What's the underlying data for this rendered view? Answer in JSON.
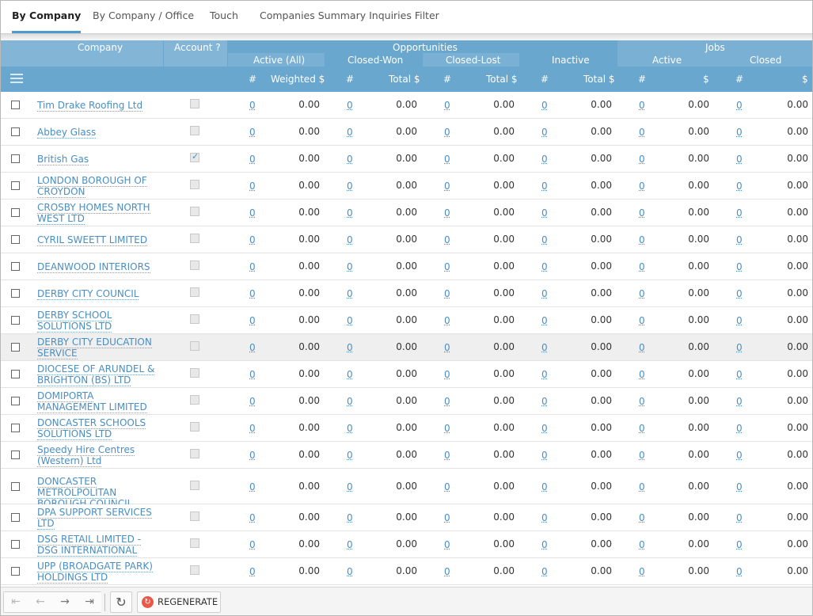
{
  "tabs": [
    {
      "label": "By Company",
      "active": true
    },
    {
      "label": "By Company / Office",
      "active": false
    },
    {
      "label": "Touch",
      "active": false
    },
    {
      "label": "Companies Summary Inquiries Filter",
      "active": false
    }
  ],
  "header": {
    "company": "Company",
    "account": "Account ?",
    "opportunities": "Opportunities",
    "jobs": "Jobs",
    "groups": [
      "Active (All)",
      "Closed-Won",
      "Closed-Lost",
      "Inactive",
      "Active",
      "Closed"
    ],
    "sub": [
      "#",
      "Weighted $",
      "#",
      "Total $",
      "#",
      "Total $",
      "#",
      "Total $",
      "#",
      "$",
      "#",
      "$"
    ]
  },
  "rows": [
    {
      "company": "Tim Drake Roofing Ltd",
      "account": false,
      "counts": [
        "0",
        "0",
        "0",
        "0",
        "0",
        "0"
      ],
      "amounts": [
        "0.00",
        "0.00",
        "0.00",
        "0.00",
        "0.00",
        "0.00"
      ]
    },
    {
      "company": "Abbey Glass",
      "account": false,
      "counts": [
        "0",
        "0",
        "0",
        "0",
        "0",
        "0"
      ],
      "amounts": [
        "0.00",
        "0.00",
        "0.00",
        "0.00",
        "0.00",
        "0.00"
      ]
    },
    {
      "company": "British Gas",
      "account": true,
      "counts": [
        "0",
        "0",
        "0",
        "0",
        "0",
        "0"
      ],
      "amounts": [
        "0.00",
        "0.00",
        "0.00",
        "0.00",
        "0.00",
        "0.00"
      ]
    },
    {
      "company": "LONDON BOROUGH OF CROYDON",
      "account": false,
      "counts": [
        "0",
        "0",
        "0",
        "0",
        "0",
        "0"
      ],
      "amounts": [
        "0.00",
        "0.00",
        "0.00",
        "0.00",
        "0.00",
        "0.00"
      ]
    },
    {
      "company": "CROSBY HOMES NORTH WEST LTD",
      "account": false,
      "counts": [
        "0",
        "0",
        "0",
        "0",
        "0",
        "0"
      ],
      "amounts": [
        "0.00",
        "0.00",
        "0.00",
        "0.00",
        "0.00",
        "0.00"
      ]
    },
    {
      "company": "CYRIL SWEETT LIMITED",
      "account": false,
      "counts": [
        "0",
        "0",
        "0",
        "0",
        "0",
        "0"
      ],
      "amounts": [
        "0.00",
        "0.00",
        "0.00",
        "0.00",
        "0.00",
        "0.00"
      ]
    },
    {
      "company": "DEANWOOD INTERIORS",
      "account": false,
      "counts": [
        "0",
        "0",
        "0",
        "0",
        "0",
        "0"
      ],
      "amounts": [
        "0.00",
        "0.00",
        "0.00",
        "0.00",
        "0.00",
        "0.00"
      ]
    },
    {
      "company": "DERBY CITY COUNCIL",
      "account": false,
      "counts": [
        "0",
        "0",
        "0",
        "0",
        "0",
        "0"
      ],
      "amounts": [
        "0.00",
        "0.00",
        "0.00",
        "0.00",
        "0.00",
        "0.00"
      ]
    },
    {
      "company": "DERBY SCHOOL SOLUTIONS LTD",
      "account": false,
      "counts": [
        "0",
        "0",
        "0",
        "0",
        "0",
        "0"
      ],
      "amounts": [
        "0.00",
        "0.00",
        "0.00",
        "0.00",
        "0.00",
        "0.00"
      ]
    },
    {
      "company": "DERBY CITY EDUCATION SERVICE",
      "account": false,
      "highlight": true,
      "counts": [
        "0",
        "0",
        "0",
        "0",
        "0",
        "0"
      ],
      "amounts": [
        "0.00",
        "0.00",
        "0.00",
        "0.00",
        "0.00",
        "0.00"
      ]
    },
    {
      "company": "DIOCESE OF ARUNDEL & BRIGHTON (BS) LTD",
      "account": false,
      "counts": [
        "0",
        "0",
        "0",
        "0",
        "0",
        "0"
      ],
      "amounts": [
        "0.00",
        "0.00",
        "0.00",
        "0.00",
        "0.00",
        "0.00"
      ]
    },
    {
      "company": "DOMIPORTA MANAGEMENT LIMITED",
      "account": false,
      "counts": [
        "0",
        "0",
        "0",
        "0",
        "0",
        "0"
      ],
      "amounts": [
        "0.00",
        "0.00",
        "0.00",
        "0.00",
        "0.00",
        "0.00"
      ]
    },
    {
      "company": "DONCASTER SCHOOLS SOLUTIONS LTD",
      "account": false,
      "counts": [
        "0",
        "0",
        "0",
        "0",
        "0",
        "0"
      ],
      "amounts": [
        "0.00",
        "0.00",
        "0.00",
        "0.00",
        "0.00",
        "0.00"
      ]
    },
    {
      "company": "Speedy Hire Centres (Western) Ltd",
      "account": false,
      "counts": [
        "0",
        "0",
        "0",
        "0",
        "0",
        "0"
      ],
      "amounts": [
        "0.00",
        "0.00",
        "0.00",
        "0.00",
        "0.00",
        "0.00"
      ]
    },
    {
      "company": "DONCASTER METROLPOLITAN BOROUGH COUNCIL",
      "account": false,
      "counts": [
        "0",
        "0",
        "0",
        "0",
        "0",
        "0"
      ],
      "amounts": [
        "0.00",
        "0.00",
        "0.00",
        "0.00",
        "0.00",
        "0.00"
      ]
    },
    {
      "company": "DPA SUPPORT SERVICES LTD",
      "account": false,
      "counts": [
        "0",
        "0",
        "0",
        "0",
        "0",
        "0"
      ],
      "amounts": [
        "0.00",
        "0.00",
        "0.00",
        "0.00",
        "0.00",
        "0.00"
      ]
    },
    {
      "company": "DSG RETAIL LIMITED - DSG INTERNATIONAL",
      "account": false,
      "counts": [
        "0",
        "0",
        "0",
        "0",
        "0",
        "0"
      ],
      "amounts": [
        "0.00",
        "0.00",
        "0.00",
        "0.00",
        "0.00",
        "0.00"
      ]
    },
    {
      "company": "UPP (BROADGATE PARK) HOLDINGS LTD",
      "account": false,
      "counts": [
        "0",
        "0",
        "0",
        "0",
        "0",
        "0"
      ],
      "amounts": [
        "0.00",
        "0.00",
        "0.00",
        "0.00",
        "0.00",
        "0.00"
      ]
    }
  ],
  "footer": {
    "regenerate_label": "REGENERATE"
  }
}
